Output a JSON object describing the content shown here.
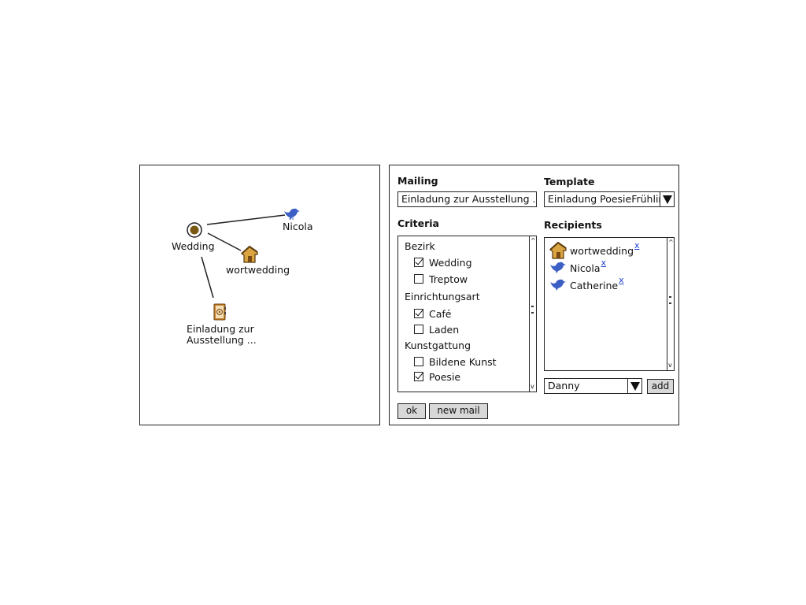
{
  "graph": {
    "nodes": {
      "wedding": "Wedding",
      "nicola": "Nicola",
      "wortwedding": "wortwedding",
      "mailing_line1": "Einladung zur",
      "mailing_line2": "Ausstellung ..."
    }
  },
  "form": {
    "mailing_label": "Mailing",
    "mailing_value": "Einladung zur Ausstellung ...",
    "template_label": "Template",
    "template_value": "Einladung PoesieFrühling",
    "criteria_label": "Criteria",
    "recipients_label": "Recipients",
    "criteria": {
      "groups": [
        {
          "label": "Bezirk",
          "items": [
            {
              "label": "Wedding",
              "checked": true
            },
            {
              "label": "Treptow",
              "checked": false
            }
          ]
        },
        {
          "label": "Einrichtungsart",
          "items": [
            {
              "label": "Café",
              "checked": true
            },
            {
              "label": "Laden",
              "checked": false
            }
          ]
        },
        {
          "label": "Kunstgattung",
          "items": [
            {
              "label": "Bildene Kunst",
              "checked": false
            },
            {
              "label": "Poesie",
              "checked": true
            }
          ]
        }
      ]
    },
    "recipients": [
      {
        "name": "wortwedding",
        "icon": "house-icon",
        "remove": "x"
      },
      {
        "name": "Nicola",
        "icon": "bird-icon",
        "remove": "x"
      },
      {
        "name": "Catherine",
        "icon": "bird-icon",
        "remove": "x"
      }
    ],
    "add_select_value": "Danny",
    "add_button": "add",
    "ok_button": "ok",
    "new_mail_button": "new mail"
  },
  "colors": {
    "link": "#1f3fcf",
    "bird": "#3b5fc4",
    "house": "#d9a441",
    "button": "#d8d8d8"
  }
}
